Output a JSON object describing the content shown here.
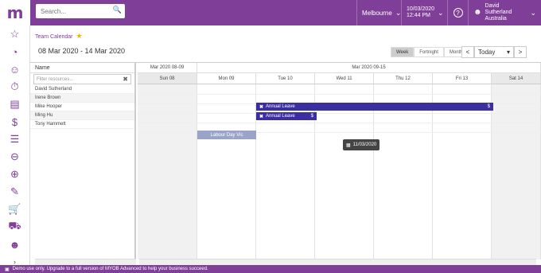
{
  "app": {
    "logo": "m"
  },
  "search": {
    "placeholder": "Search..."
  },
  "topbar": {
    "location": "Melbourne",
    "date": "10/03/2020",
    "time": "12:44 PM",
    "help": "?",
    "user_name": "David Sutherland",
    "user_loc": "Australia"
  },
  "breadcrumb": {
    "label": "Team Calendar"
  },
  "range_title": "08 Mar 2020 - 14 Mar 2020",
  "views": {
    "week": "Week",
    "fortnight": "Fortnight",
    "month": "Month"
  },
  "nav": {
    "prev": "<",
    "today": "Today",
    "next": ">"
  },
  "resources": {
    "header": "Name",
    "filter_placeholder": "Filter resources...",
    "items": [
      "David Sutherland",
      "Irene Brown",
      "Mike Hooper",
      "Ming Hu",
      "Tony Hammett"
    ]
  },
  "calendar": {
    "weeks": [
      "Mar 2020 08-09",
      "Mar 2020 09-15"
    ],
    "days": [
      "Sun 08",
      "Mon 09",
      "Tue 10",
      "Wed 11",
      "Thu 12",
      "Fri 13",
      "Sat 14"
    ],
    "events": [
      {
        "label": "Annual Leave",
        "suffix": "$"
      },
      {
        "label": "Annual Leave",
        "suffix": "$"
      }
    ],
    "holiday": "Labour Day Vic",
    "tooltip": "11/03/2020"
  },
  "footer": {
    "text": "Demo use only. Upgrade to a full version of MYOB Advanced to help your business succeed."
  },
  "colors": {
    "brand": "#7f3f98",
    "event": "#3a2ea0",
    "holiday": "#9aa4c8"
  }
}
